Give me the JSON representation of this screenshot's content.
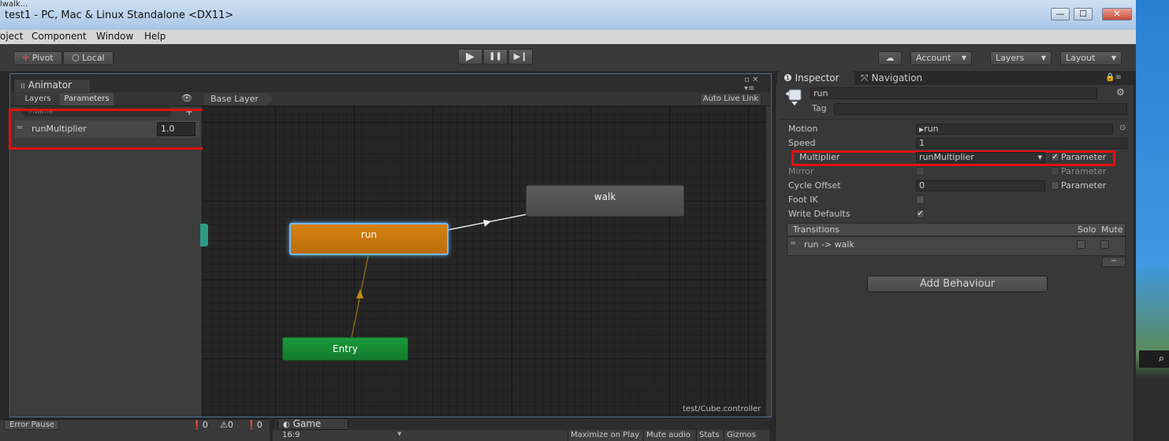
{
  "window": {
    "top_fragment": "lwalk...",
    "title": "test1 - PC, Mac & Linux Standalone <DX11>",
    "min": "—",
    "max": "☐",
    "close": "✕"
  },
  "menu": [
    "oject",
    "Component",
    "Window",
    "Help"
  ],
  "toolbar": {
    "pivot": "Pivot",
    "local": "Local",
    "play": "▶",
    "pause": "❚❚",
    "step": "▶❙",
    "cloud": "☁",
    "account": "Account",
    "layers": "Layers",
    "layout": "Layout"
  },
  "animator": {
    "tab": "Animator",
    "layers_tab": "Layers",
    "parameters_tab": "Parameters",
    "search_placeholder": "Name",
    "add": "+",
    "base_layer": "Base Layer",
    "auto_live_link": "Auto Live Link",
    "parameter": {
      "name": "runMultiplier",
      "value": "1.0"
    },
    "path": "test/Cube.controller",
    "states": {
      "run": "run",
      "walk": "walk",
      "entry": "Entry"
    }
  },
  "console": {
    "error_pause": "Error Pause",
    "errors": "0",
    "warnings": "0",
    "logs": "0"
  },
  "game": {
    "tab": "Game",
    "aspect": "16:9",
    "maximize": "Maximize on Play",
    "mute": "Mute audio",
    "stats": "Stats",
    "gizmos": "Gizmos"
  },
  "inspector": {
    "tab": "Inspector",
    "nav_tab": "Navigation",
    "name": "run",
    "tag_label": "Tag",
    "motion_label": "Motion",
    "motion_value": "run",
    "speed_label": "Speed",
    "speed_value": "1",
    "multiplier_label": "Multiplier",
    "multiplier_value": "runMultiplier",
    "parameter_label": "Parameter",
    "mirror_label": "Mirror",
    "cycle_label": "Cycle Offset",
    "cycle_value": "0",
    "footik_label": "Foot IK",
    "writedef_label": "Write Defaults",
    "transitions_label": "Transitions",
    "solo": "Solo",
    "mute": "Mute",
    "transition": "run -> walk",
    "minus": "−",
    "add_behaviour": "Add Behaviour"
  }
}
